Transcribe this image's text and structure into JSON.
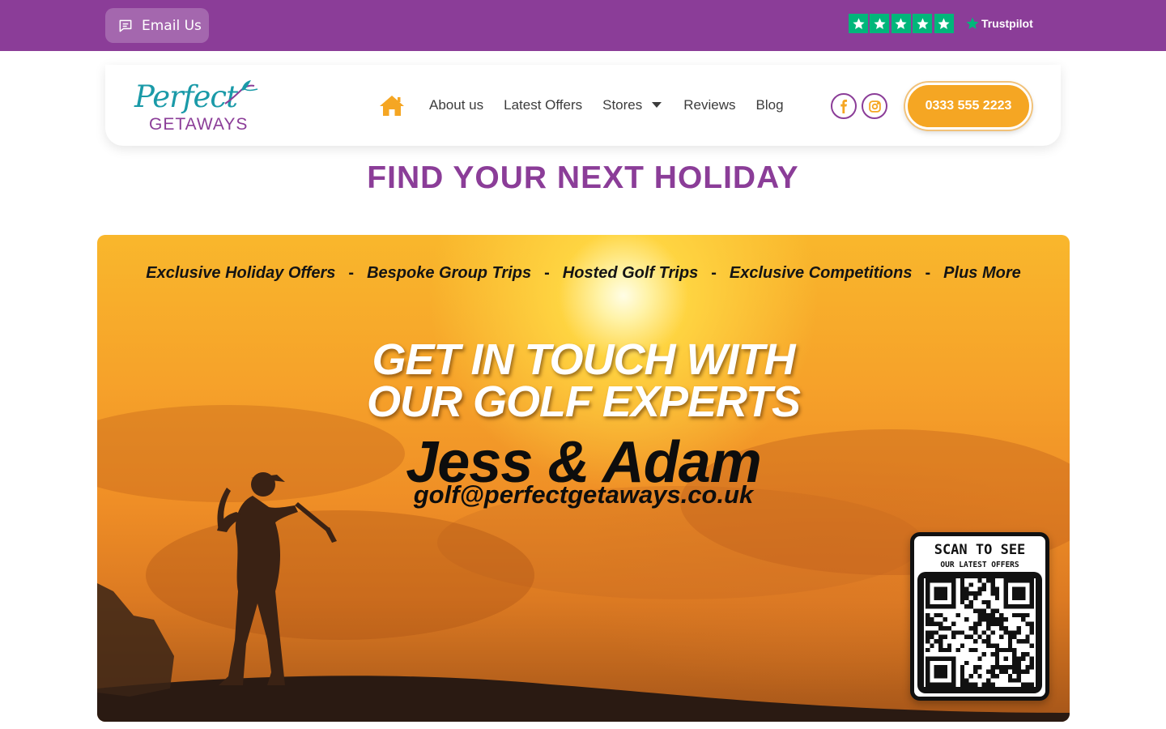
{
  "topbar": {
    "email_label": "Email Us",
    "trustpilot_label": "Trustpilot",
    "trustpilot_stars": 5,
    "colors": {
      "bar": "#8b3d98",
      "trustpilot_green": "#00b67a"
    }
  },
  "header": {
    "logo": {
      "line1": "Perfect",
      "line2": "GETAWAYS"
    },
    "nav": {
      "home_icon": "home-icon",
      "items": [
        {
          "label": "About us"
        },
        {
          "label": "Latest Offers"
        },
        {
          "label": "Stores"
        },
        {
          "label": "Reviews"
        },
        {
          "label": "Blog"
        }
      ]
    },
    "social": [
      "facebook-icon",
      "instagram-icon"
    ],
    "phone": "0333 555 2223",
    "colors": {
      "accent_orange": "#f5a623",
      "brand_purple": "#8b3d98"
    }
  },
  "main": {
    "title": "FIND YOUR NEXT HOLIDAY",
    "banner": {
      "taglines": [
        "Exclusive Holiday Offers",
        "Bespoke Group Trips",
        "Hosted Golf Trips",
        "Exclusive Competitions",
        "Plus More"
      ],
      "separator": "-",
      "headline_line1": "GET IN TOUCH WITH",
      "headline_line2": "OUR GOLF EXPERTS",
      "names": "Jess & Adam",
      "email": "golf@perfectgetaways.co.uk",
      "qr": {
        "title": "SCAN TO SEE",
        "subtitle": "OUR LATEST OFFERS"
      }
    }
  }
}
